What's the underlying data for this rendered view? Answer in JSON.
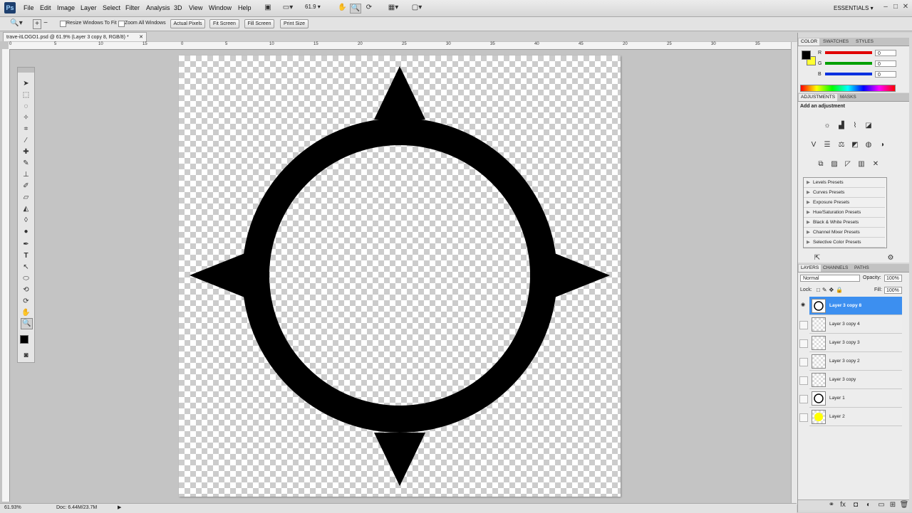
{
  "app": {
    "logo": "Ps",
    "workspace": "ESSENTIALS",
    "accent": "#3c8ff0"
  },
  "menu": [
    "File",
    "Edit",
    "Image",
    "Layer",
    "Select",
    "Filter",
    "Analysis",
    "3D",
    "View",
    "Window",
    "Help"
  ],
  "toolbar": {
    "zoom_value": "61.9"
  },
  "options": {
    "resize_windows_label": "Resize Windows To Fit",
    "zoom_all_label": "Zoom All Windows",
    "actual_pixels": "Actual Pixels",
    "fit_screen": "Fit Screen",
    "fill_screen": "Fill Screen",
    "print_size": "Print Size"
  },
  "document": {
    "tab_title": "trave-itLOGO1.psd @ 61.9% (Layer 3 copy 8, RGB/8) *"
  },
  "rulers": {
    "top": [
      "0",
      "5",
      "10",
      "15",
      "20",
      "25",
      "30",
      "35",
      "0",
      "5",
      "10",
      "15",
      "20",
      "25",
      "30",
      "35",
      "40",
      "45"
    ]
  },
  "status": {
    "zoom": "61.93%",
    "doc": "Doc: 6.44M/23.7M"
  },
  "color_panel": {
    "tabs": [
      "COLOR",
      "SWATCHES",
      "STYLES"
    ],
    "channels": [
      {
        "label": "R",
        "value": "0",
        "color": "#e00000"
      },
      {
        "label": "G",
        "value": "0",
        "color": "#00a000"
      },
      {
        "label": "B",
        "value": "0",
        "color": "#0030e0"
      }
    ],
    "foreground": "#000000",
    "background": "#ffff33"
  },
  "adjustments": {
    "tabs": [
      "ADJUSTMENTS",
      "MASKS"
    ],
    "heading": "Add an adjustment",
    "presets": [
      "Levels Presets",
      "Curves Presets",
      "Exposure Presets",
      "Hue/Saturation Presets",
      "Black & White Presets",
      "Channel Mixer Presets",
      "Selective Color Presets"
    ]
  },
  "layers_panel": {
    "tabs": [
      "LAYERS",
      "CHANNELS",
      "PATHS"
    ],
    "blend_mode": "Normal",
    "opacity_label": "Opacity:",
    "opacity": "100%",
    "lock_label": "Lock:",
    "fill_label": "Fill:",
    "fill": "100%",
    "layers": [
      {
        "name": "Layer 3 copy 8",
        "selected": true,
        "visible": true,
        "thumb": "ring"
      },
      {
        "name": "Layer 3 copy 4",
        "selected": false,
        "visible": false,
        "thumb": "empty"
      },
      {
        "name": "Layer 3 copy 3",
        "selected": false,
        "visible": false,
        "thumb": "empty"
      },
      {
        "name": "Layer 3 copy 2",
        "selected": false,
        "visible": false,
        "thumb": "empty"
      },
      {
        "name": "Layer 3 copy",
        "selected": false,
        "visible": false,
        "thumb": "empty"
      },
      {
        "name": "Layer 1",
        "selected": false,
        "visible": false,
        "thumb": "ring"
      },
      {
        "name": "Layer 2",
        "selected": false,
        "visible": false,
        "thumb": "yellow"
      }
    ]
  }
}
